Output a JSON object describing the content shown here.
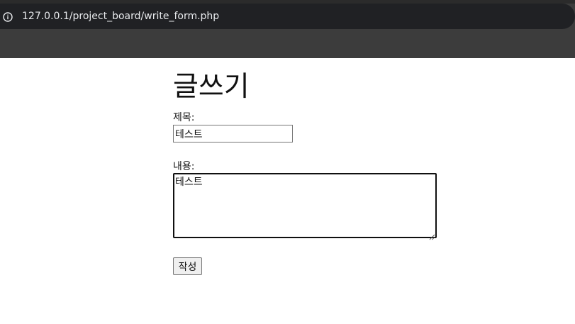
{
  "browser": {
    "url": "127.0.0.1/project_board/write_form.php",
    "site_info_icon": "info-icon"
  },
  "form": {
    "heading": "글쓰기",
    "title_label": "제목:",
    "title_value": "테스트",
    "content_label": "내용:",
    "content_value": "테스트",
    "submit_label": "작성"
  },
  "colors": {
    "chrome_background": "#3c3c3c",
    "address_bar_background": "#202124",
    "url_text": "#e8eaed",
    "page_background": "#ffffff",
    "button_background": "#efefef"
  }
}
